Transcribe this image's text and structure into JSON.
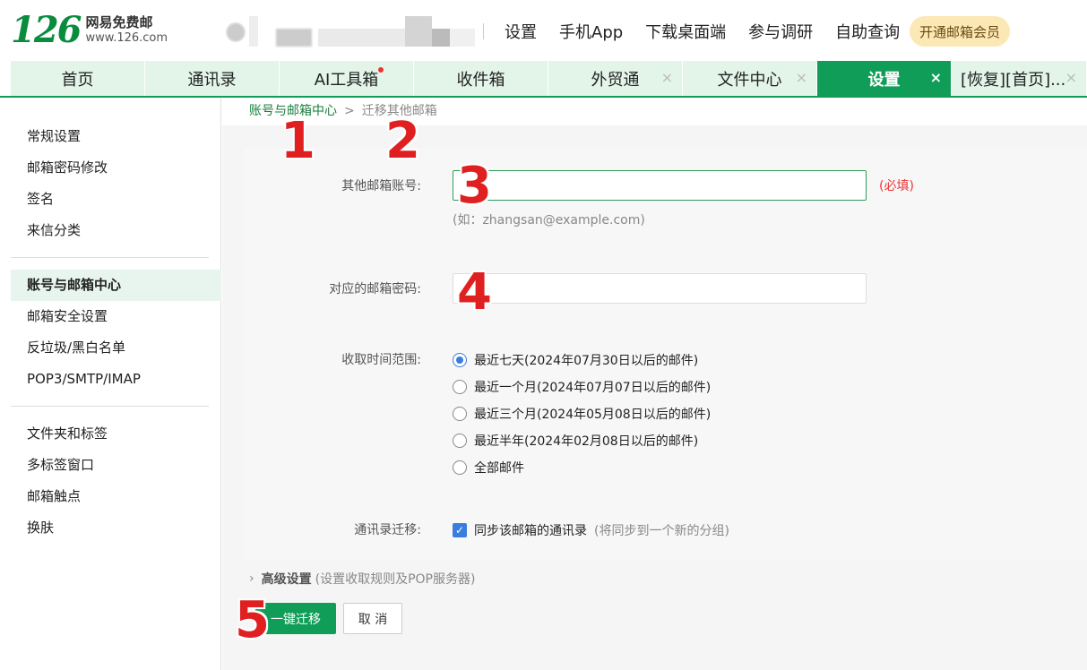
{
  "logo": {
    "number": "126",
    "name": "网易免费邮",
    "url": "www.126.com"
  },
  "topnav": [
    "设置",
    "手机App",
    "下载桌面端",
    "参与调研",
    "自助查询"
  ],
  "vip_label": "开通邮箱会员",
  "tabs": [
    {
      "label": "首页",
      "closable": false
    },
    {
      "label": "通讯录",
      "closable": false
    },
    {
      "label": "AI工具箱",
      "closable": false,
      "dot": true
    },
    {
      "label": "收件箱",
      "closable": false
    },
    {
      "label": "外贸通",
      "closable": true
    },
    {
      "label": "文件中心",
      "closable": true
    },
    {
      "label": "设置",
      "closable": true,
      "active": true
    },
    {
      "label": "[恢复][首页]...",
      "closable": true
    }
  ],
  "close_glyph": "×",
  "sidebar": {
    "group1": [
      "常规设置",
      "邮箱密码修改",
      "签名",
      "来信分类"
    ],
    "group2": [
      "账号与邮箱中心",
      "邮箱安全设置",
      "反垃圾/黑白名单",
      "POP3/SMTP/IMAP"
    ],
    "group3": [
      "文件夹和标签",
      "多标签窗口",
      "邮箱触点",
      "换肤"
    ],
    "active": "账号与邮箱中心"
  },
  "breadcrumb": {
    "parent": "账号与邮箱中心",
    "arrow": ">",
    "current": "迁移其他邮箱"
  },
  "form": {
    "account_label": "其他邮箱账号:",
    "account_value": "",
    "required": "(必填)",
    "account_hint": "(如：zhangsan@example.com)",
    "password_label": "对应的邮箱密码:",
    "password_value": "",
    "range_label": "收取时间范围:",
    "range_options": [
      "最近七天(2024年07月30日以后的邮件)",
      "最近一个月(2024年07月07日以后的邮件)",
      "最近三个月(2024年05月08日以后的邮件)",
      "最近半年(2024年02月08日以后的邮件)",
      "全部邮件"
    ],
    "range_selected": 0,
    "contacts_label": "通讯录迁移:",
    "contacts_checkbox": "同步该邮箱的通讯录",
    "contacts_checked": true,
    "contacts_note": "(将同步到一个新的分组)"
  },
  "advanced": {
    "title": "高级设置",
    "desc": "(设置收取规则及POP服务器)"
  },
  "buttons": {
    "migrate": "一键迁移",
    "cancel": "取 消"
  },
  "markers": [
    "1",
    "2",
    "3",
    "4",
    "5"
  ],
  "colors": {
    "brand_green": "#0f9d58",
    "tab_bg": "#e3f4e9",
    "marker_red": "#e02020",
    "radio_blue": "#3b7ddd",
    "required_red": "#e33333"
  }
}
